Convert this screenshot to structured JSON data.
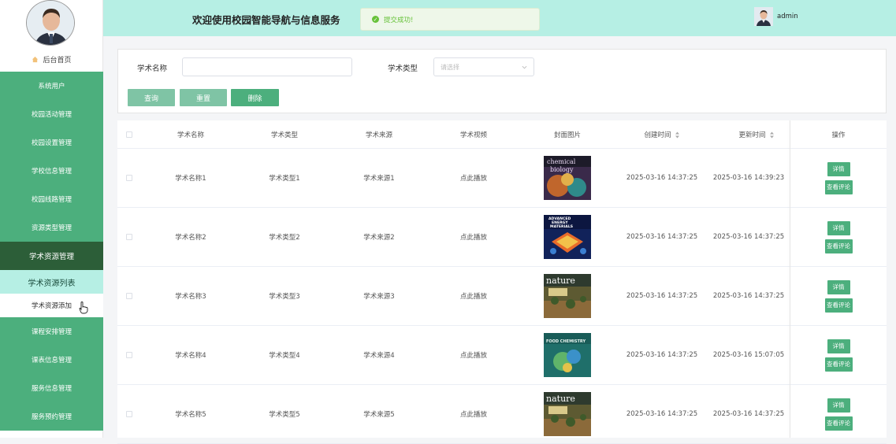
{
  "sidebar": {
    "home_label": "后台首页",
    "menu_top": [
      "系统用户",
      "校园活动管理",
      "校园设置管理",
      "学校信息管理",
      "校园线路管理",
      "资源类型管理"
    ],
    "active_menu": "学术资源管理",
    "sub_items": [
      "学术资源列表",
      "学术资源添加"
    ],
    "menu_bottom": [
      "课程安排管理",
      "课表信息管理",
      "服务信息管理",
      "服务预约管理"
    ]
  },
  "header": {
    "title": "欢迎使用校园智能导航与信息服务",
    "toast": "提交成功!",
    "username": "admin"
  },
  "search": {
    "name_label": "学术名称",
    "name_value": "",
    "type_label": "学术类型",
    "type_placeholder": "请选择",
    "query_label": "查询",
    "reset_label": "重置",
    "delete_label": "删除"
  },
  "table": {
    "columns": [
      "学术名称",
      "学术类型",
      "学术来源",
      "学术视频",
      "封面图片",
      "创建时间",
      "更新时间",
      "操作"
    ],
    "rows": [
      {
        "name": "学术名称1",
        "type": "学术类型1",
        "source": "学术来源1",
        "video": "点此播放",
        "cover": "chemical biology",
        "created": "2025-03-16 14:37:25",
        "updated": "2025-03-16 14:39:23"
      },
      {
        "name": "学术名称2",
        "type": "学术类型2",
        "source": "学术来源2",
        "video": "点此播放",
        "cover": "advanced energy materials",
        "created": "2025-03-16 14:37:25",
        "updated": "2025-03-16 14:37:25"
      },
      {
        "name": "学术名称3",
        "type": "学术类型3",
        "source": "学术来源3",
        "video": "点此播放",
        "cover": "nature",
        "created": "2025-03-16 14:37:25",
        "updated": "2025-03-16 14:37:25"
      },
      {
        "name": "学术名称4",
        "type": "学术类型4",
        "source": "学术来源4",
        "video": "点此播放",
        "cover": "food chemistry",
        "created": "2025-03-16 14:37:25",
        "updated": "2025-03-16 15:07:05"
      },
      {
        "name": "学术名称5",
        "type": "学术类型5",
        "source": "学术来源5",
        "video": "点此播放",
        "cover": "nature",
        "created": "2025-03-16 14:37:25",
        "updated": "2025-03-16 14:37:25"
      }
    ],
    "detail_label": "详情",
    "comment_label": "查看评论"
  },
  "colors": {
    "primary": "#4caf7d",
    "menu_active": "#2c5e38",
    "header_bg": "#b6efe4",
    "success": "#67c23a"
  }
}
